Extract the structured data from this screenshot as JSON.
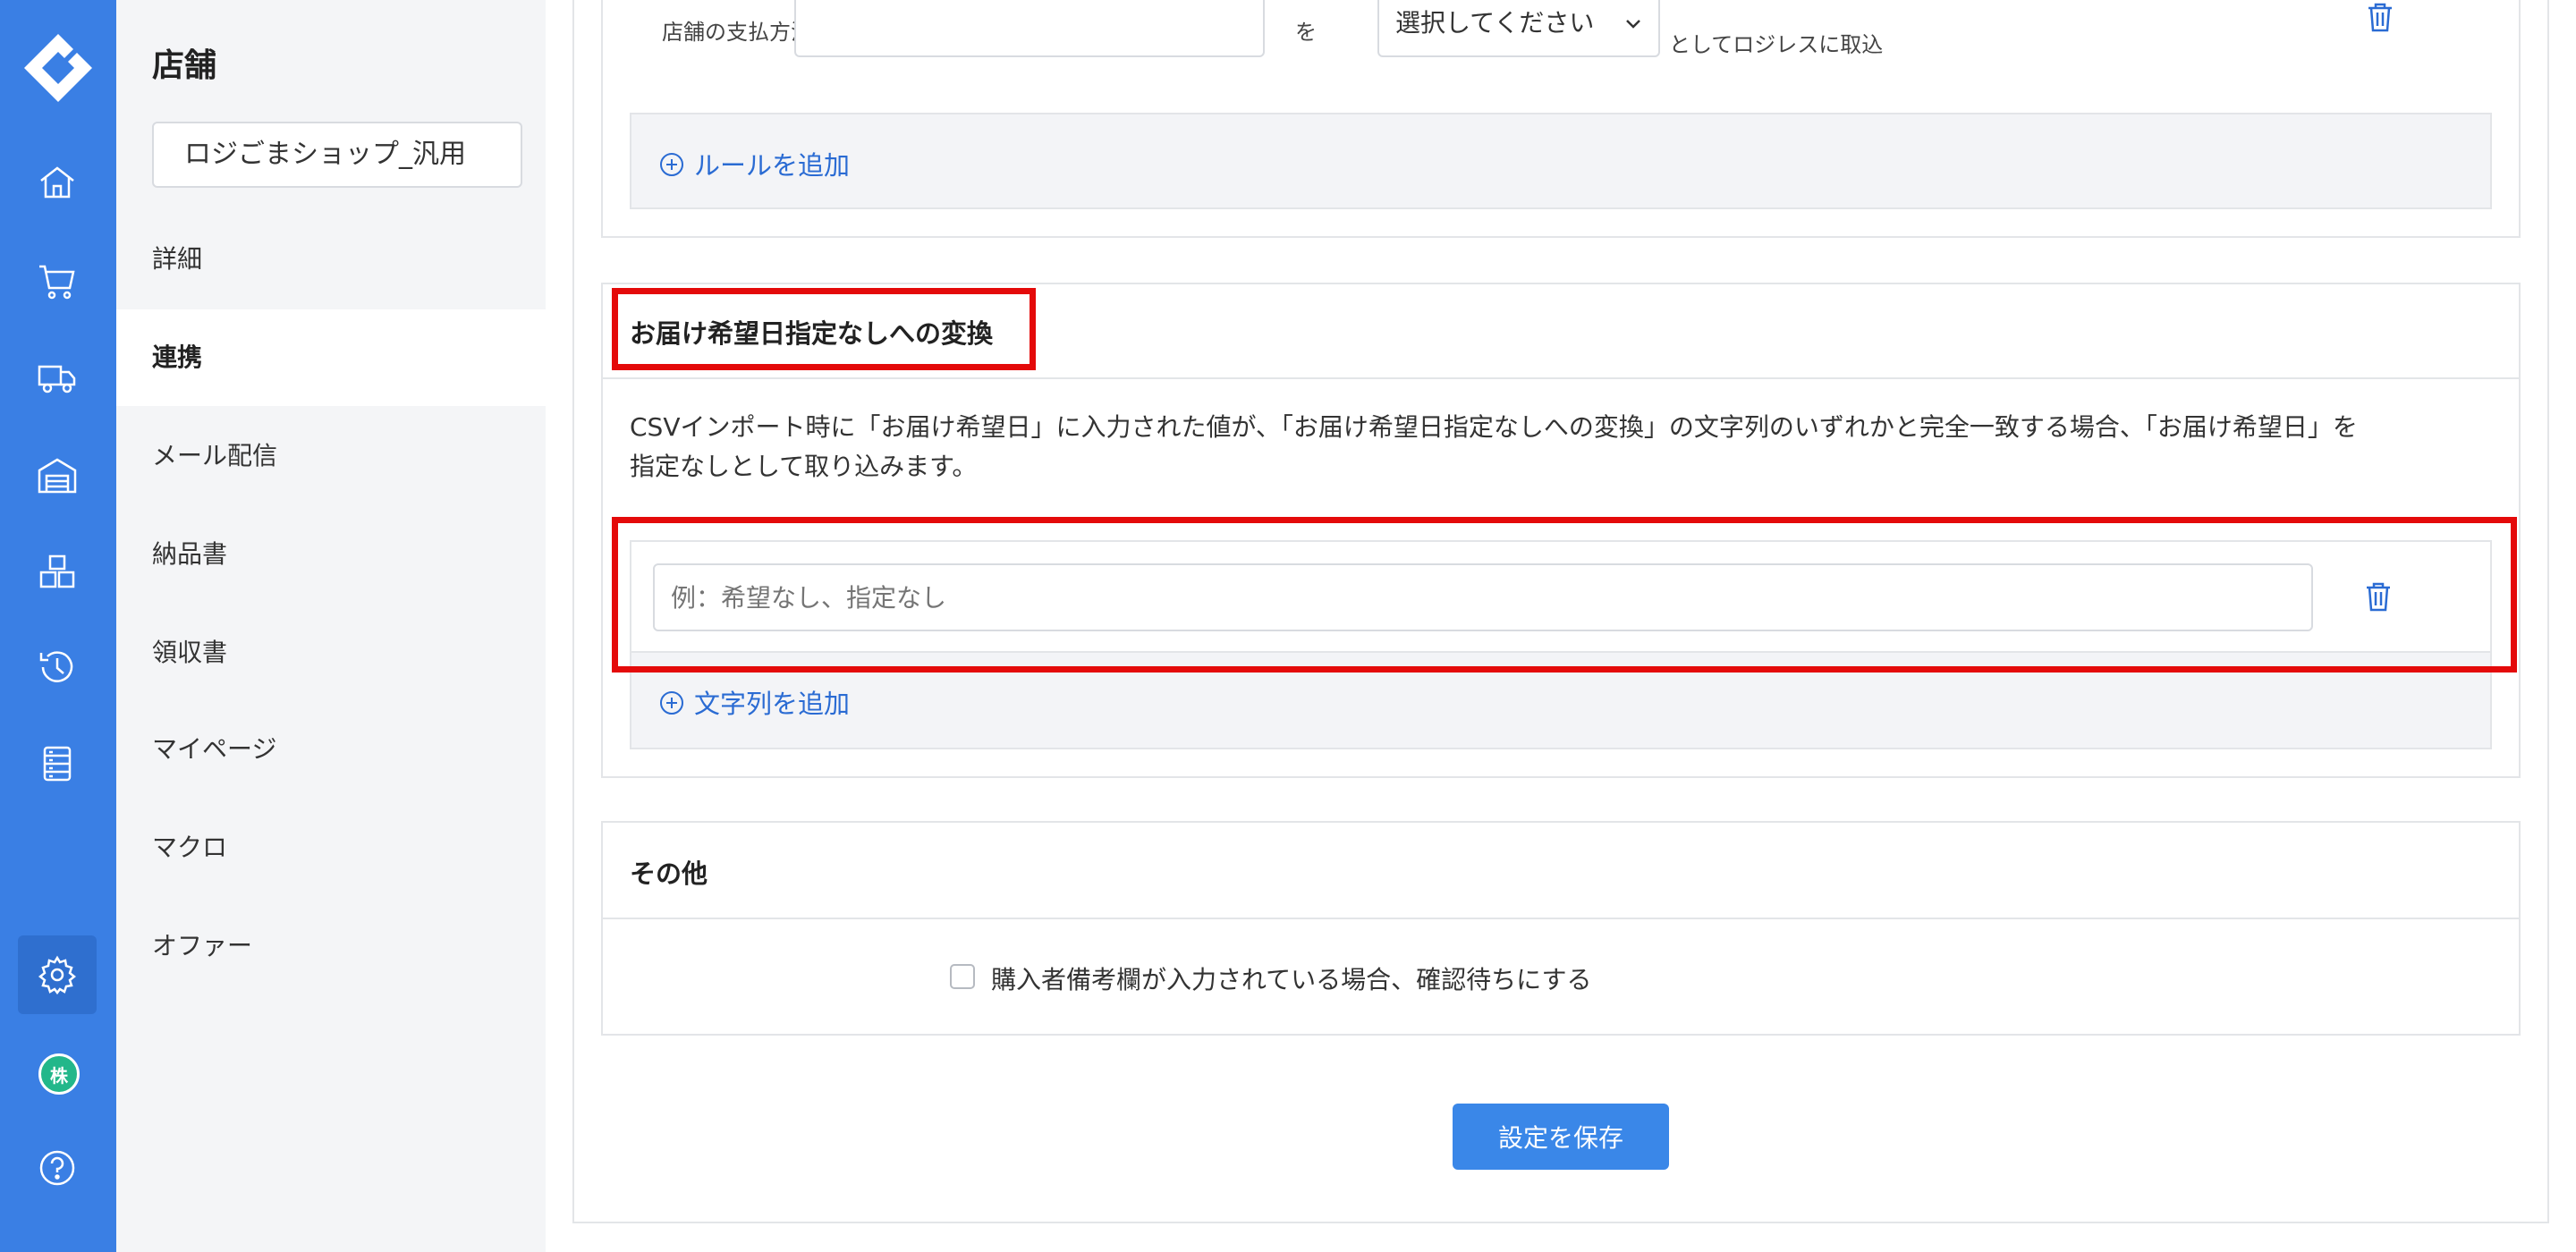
{
  "sidebar": {
    "title": "店舗",
    "shop_select_value": "ロジごまショップ_汎用",
    "items": [
      {
        "label": "詳細"
      },
      {
        "label": "連携"
      },
      {
        "label": "メール配信"
      },
      {
        "label": "納品書"
      },
      {
        "label": "領収書"
      },
      {
        "label": "マイページ"
      },
      {
        "label": "マクロ"
      },
      {
        "label": "オファー"
      }
    ],
    "active_item": "連携"
  },
  "rail": {
    "icons": [
      "logo-icon",
      "home-icon",
      "cart-icon",
      "truck-icon",
      "warehouse-icon",
      "boxes-icon",
      "history-icon",
      "list-icon",
      "gear-icon",
      "company-badge",
      "help-icon"
    ],
    "user_badge": "株",
    "accent": "#3a7fe4"
  },
  "payment_rule": {
    "label": "店舗の支払方法",
    "wo": "を",
    "select_placeholder": "選択してください",
    "suffix": "としてロジレスに取込",
    "add_rule_label": "ルールを追加"
  },
  "no_date_section": {
    "title": "お届け希望日指定なしへの変換",
    "description_line1": "CSVインポート時に「お届け希望日」に入力された値が、「お届け希望日指定なしへの変換」の文字列のいずれかと完全一致する場合、「お届け希望日」を",
    "description_line2": "指定なしとして取り込みます。",
    "input_placeholder": "例：希望なし、指定なし",
    "add_string_label": "文字列を追加"
  },
  "other_section": {
    "title": "その他",
    "checkbox_label": "購入者備考欄が入力されている場合、確認待ちにする"
  },
  "save_button_label": "設定を保存",
  "highlight_color": "#e40a0a"
}
